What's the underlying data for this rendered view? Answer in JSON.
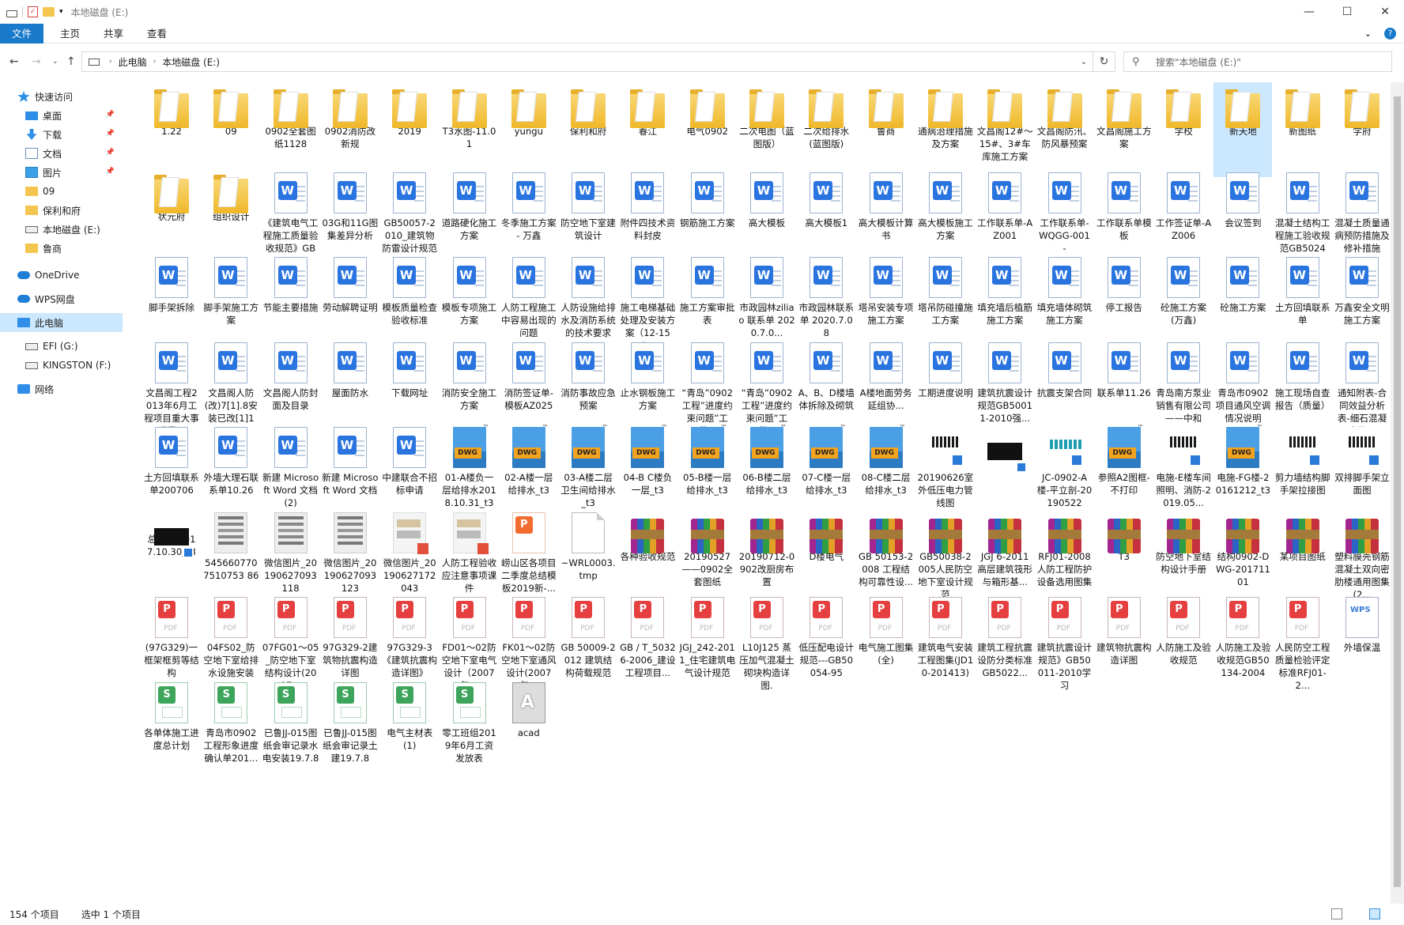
{
  "window": {
    "title": "本地磁盘 (E:)",
    "min": "—",
    "max": "☐",
    "close": "✕"
  },
  "ribbon": {
    "tabs": [
      "文件",
      "主页",
      "共享",
      "查看"
    ]
  },
  "address": {
    "crumbs": [
      "此电脑",
      "本地磁盘 (E:)"
    ],
    "search_placeholder": "搜索\"本地磁盘 (E:)\""
  },
  "sidebar": [
    {
      "label": "快速访问",
      "icon": "star-icon",
      "pinned": false
    },
    {
      "label": "桌面",
      "icon": "desktop-icon",
      "pinned": true
    },
    {
      "label": "下载",
      "icon": "download-icon",
      "pinned": true
    },
    {
      "label": "文档",
      "icon": "document-icon",
      "pinned": true
    },
    {
      "label": "图片",
      "icon": "picture-icon",
      "pinned": true
    },
    {
      "label": "09",
      "icon": "folder-icon",
      "pinned": false
    },
    {
      "label": "保利和府",
      "icon": "folder-icon",
      "pinned": false
    },
    {
      "label": "本地磁盘 (E:)",
      "icon": "drive-icon",
      "pinned": false
    },
    {
      "label": "鲁商",
      "icon": "folder-icon",
      "pinned": false
    },
    {
      "label": "OneDrive",
      "icon": "cloud-icon",
      "pinned": false
    },
    {
      "label": "WPS网盘",
      "icon": "cloud-icon",
      "pinned": false
    },
    {
      "label": "此电脑",
      "icon": "computer-icon",
      "pinned": false
    },
    {
      "label": "EFI (G:)",
      "icon": "drive-icon",
      "pinned": false
    },
    {
      "label": "KINGSTON (F:)",
      "icon": "drive-icon",
      "pinned": false
    },
    {
      "label": "网络",
      "icon": "network-icon",
      "pinned": false
    }
  ],
  "status": {
    "count": "154 个项目",
    "selected": "选中 1 个项目"
  },
  "files": [
    {
      "name": "1.22",
      "type": "folder"
    },
    {
      "name": "09",
      "type": "folder"
    },
    {
      "name": "0902全套图纸1128",
      "type": "folder"
    },
    {
      "name": "0902消防改新规",
      "type": "folder"
    },
    {
      "name": "2019",
      "type": "folder"
    },
    {
      "name": "T3水图-11.01",
      "type": "folder"
    },
    {
      "name": "yungu",
      "type": "folder"
    },
    {
      "name": "保利和府",
      "type": "folder"
    },
    {
      "name": "春江",
      "type": "folder"
    },
    {
      "name": "电气0902",
      "type": "folder"
    },
    {
      "name": "二次电图（蓝图版）",
      "type": "folder"
    },
    {
      "name": "二次给排水(蓝图版)",
      "type": "folder"
    },
    {
      "name": "鲁商",
      "type": "folder"
    },
    {
      "name": "通病治理措施及方案",
      "type": "folder"
    },
    {
      "name": "文昌阁12#～15#、3#车库施工方案",
      "type": "folder"
    },
    {
      "name": "文昌阁防汛、防风暴预案",
      "type": "folder"
    },
    {
      "name": "文昌阁施工方案",
      "type": "folder"
    },
    {
      "name": "学校",
      "type": "folder"
    },
    {
      "name": "新天地",
      "type": "folder",
      "selected": true
    },
    {
      "name": "新图纸",
      "type": "folder"
    },
    {
      "name": "学府",
      "type": "folder"
    },
    {
      "name": "状元府",
      "type": "folder"
    },
    {
      "name": "组织设计",
      "type": "folder"
    },
    {
      "name": "《建筑电气工程施工质量验收规范》GB5...",
      "type": "word"
    },
    {
      "name": "03G和11G图集差异分析",
      "type": "word"
    },
    {
      "name": "GB50057-2010_建筑物防雷设计规范",
      "type": "word"
    },
    {
      "name": "道路硬化施工方案",
      "type": "word"
    },
    {
      "name": "冬季施工方案 - 万鑫",
      "type": "word"
    },
    {
      "name": "防空地下室建筑设计",
      "type": "word"
    },
    {
      "name": "附件四技术资料封皮",
      "type": "word"
    },
    {
      "name": "钢筋施工方案",
      "type": "word"
    },
    {
      "name": "高大模板",
      "type": "word"
    },
    {
      "name": "高大模板1",
      "type": "word"
    },
    {
      "name": "高大模板计算书",
      "type": "word"
    },
    {
      "name": "高大模板施工方案",
      "type": "word"
    },
    {
      "name": "工作联系单-AZ001",
      "type": "word"
    },
    {
      "name": "工作联系单-WQGG-001 -",
      "type": "word"
    },
    {
      "name": "工作联系单模板",
      "type": "word"
    },
    {
      "name": "工作签证单-AZ006",
      "type": "word"
    },
    {
      "name": "会议签到",
      "type": "word"
    },
    {
      "name": "混凝土结构工程施工验收规范GB5024-...",
      "type": "word"
    },
    {
      "name": "混凝土质量通病预防措施及修补措施",
      "type": "word"
    },
    {
      "name": "脚手架拆除",
      "type": "word"
    },
    {
      "name": "脚手架施工方案",
      "type": "word"
    },
    {
      "name": "节能主要措施",
      "type": "word"
    },
    {
      "name": "劳动解聘证明",
      "type": "word"
    },
    {
      "name": "模板质量检查验收标准",
      "type": "word"
    },
    {
      "name": "模板专项施工方案",
      "type": "word"
    },
    {
      "name": "人防工程施工中容易出现的问题",
      "type": "word"
    },
    {
      "name": "人防设施给排水及消防系统的技术要求",
      "type": "word"
    },
    {
      "name": "施工电梯基础处理及安装方案（12-15#...",
      "type": "word"
    },
    {
      "name": "施工方案审批表",
      "type": "word"
    },
    {
      "name": "市政园林ziliao 联系单 2020.7.0...",
      "type": "word"
    },
    {
      "name": "市政园林联系单 2020.7.08",
      "type": "word"
    },
    {
      "name": "塔吊安装专项施工方案",
      "type": "word"
    },
    {
      "name": "塔吊防碰撞施工方案",
      "type": "word"
    },
    {
      "name": "填充墙后植筋施工方案",
      "type": "word"
    },
    {
      "name": "填充墙体砌筑施工方案",
      "type": "word"
    },
    {
      "name": "停工报告",
      "type": "word"
    },
    {
      "name": "砼施工方案(万鑫)",
      "type": "word"
    },
    {
      "name": "砼施工方案",
      "type": "word"
    },
    {
      "name": "土方回填联系单",
      "type": "word"
    },
    {
      "name": "万鑫安全文明施工方案",
      "type": "word"
    },
    {
      "name": "文昌阁工程2013年6月工程项目重大事项风...",
      "type": "word"
    },
    {
      "name": "文昌阁人防(改)7[1].8安装已改[1]1",
      "type": "word"
    },
    {
      "name": "文昌阁人防封面及目录",
      "type": "word"
    },
    {
      "name": "屋面防水",
      "type": "word"
    },
    {
      "name": "下载网址",
      "type": "word"
    },
    {
      "name": "消防安全施工方案",
      "type": "word"
    },
    {
      "name": "消防签证单-模板AZ025",
      "type": "word"
    },
    {
      "name": "消防事故应急预案",
      "type": "word"
    },
    {
      "name": "止水钢板施工方案",
      "type": "word"
    },
    {
      "name": "“青岛”0902工程”进度约束问题”工程...",
      "type": "word"
    },
    {
      "name": "“青岛”0902工程”进度约束问题”工程...",
      "type": "word"
    },
    {
      "name": "A、B、D楼墙体拆除及砌筑",
      "type": "word"
    },
    {
      "name": "A楼地面劳务延组协...",
      "type": "word"
    },
    {
      "name": "工期进度说明",
      "type": "word"
    },
    {
      "name": "建筑抗震设计规范GB50011-2010强...",
      "type": "word"
    },
    {
      "name": "抗震支架合同",
      "type": "word"
    },
    {
      "name": "联系单11.26",
      "type": "word"
    },
    {
      "name": "青岛南方泵业销售有限公司——中和",
      "type": "word"
    },
    {
      "name": "青岛市0902项目通风空调情况说明",
      "type": "word"
    },
    {
      "name": "施工现场自查报告（质量）",
      "type": "word"
    },
    {
      "name": "通知附表-合同效益分析表-细石混凝土施...",
      "type": "word"
    },
    {
      "name": "土方回填联系单200706",
      "type": "word"
    },
    {
      "name": "外墙大理石联系单10.26",
      "type": "word"
    },
    {
      "name": "新建 Microsoft Word 文档 (2)",
      "type": "word"
    },
    {
      "name": "新建 Microsoft Word 文档",
      "type": "word"
    },
    {
      "name": "中建联合不招标申请",
      "type": "word"
    },
    {
      "name": "01-A楼负一层给排水2018.10.31_t3",
      "type": "dwg"
    },
    {
      "name": "02-A楼一层给排水_t3",
      "type": "dwg"
    },
    {
      "name": "03-A楼二层卫生间给排水_t3",
      "type": "dwg"
    },
    {
      "name": "04-B C楼负一层_t3",
      "type": "dwg"
    },
    {
      "name": "05-B楼一层给排水_t3",
      "type": "dwg"
    },
    {
      "name": "06-B楼二层给排水_t3",
      "type": "dwg"
    },
    {
      "name": "07-C楼一层给排水_t3",
      "type": "dwg"
    },
    {
      "name": "08-C楼二层给排水_t3",
      "type": "dwg"
    },
    {
      "name": "20190626室外低压电力管线图",
      "type": "mixed"
    },
    {
      "name": "D楼宿舍",
      "type": "dark"
    },
    {
      "name": "JC-0902-A楼-平立剖-20190522",
      "type": "cyan"
    },
    {
      "name": "参照A2图框-不打印",
      "type": "dwg"
    },
    {
      "name": "电施-E楼车间照明、消防-2019.05...",
      "type": "mixed"
    },
    {
      "name": "电施-FG楼-20161212_t3",
      "type": "dwg"
    },
    {
      "name": "剪力墙结构脚手架拉接图",
      "type": "mixed"
    },
    {
      "name": "双排脚手架立面图",
      "type": "mixed"
    },
    {
      "name": "总说明-2017.10.30_t3",
      "type": "dark"
    },
    {
      "name": "5456607707510753 86",
      "type": "img"
    },
    {
      "name": "微信图片_20190627093118",
      "type": "img"
    },
    {
      "name": "微信图片_20190627093123",
      "type": "img"
    },
    {
      "name": "微信图片_20190627172043",
      "type": "thumb"
    },
    {
      "name": "人防工程验收应注意事项课件",
      "type": "thumb"
    },
    {
      "name": "崂山区各项目二季度总结模板2019新-...",
      "type": "ppt"
    },
    {
      "name": "~WRL0003.tmp",
      "type": "tmp"
    },
    {
      "name": "各种验收规范",
      "type": "rar"
    },
    {
      "name": "20190527——0902全套图纸",
      "type": "rar"
    },
    {
      "name": "20190712-0902改厨房布置",
      "type": "rar"
    },
    {
      "name": "D楼电气",
      "type": "rar"
    },
    {
      "name": "GB 50153-2008 工程结构可靠性设...",
      "type": "rar"
    },
    {
      "name": "GB50038-2005人民防空地下室设计规范",
      "type": "rar"
    },
    {
      "name": "JGJ 6-2011 高层建筑筏形与箱形基...",
      "type": "rar"
    },
    {
      "name": "RFJ01-2008人防工程防护设备选用图集",
      "type": "rar"
    },
    {
      "name": "T3",
      "type": "rar"
    },
    {
      "name": "防空地下室结构设计手册",
      "type": "rar"
    },
    {
      "name": "结构0902-DWG-20171101",
      "type": "rar"
    },
    {
      "name": "某项目图纸",
      "type": "rar"
    },
    {
      "name": "塑料膜壳钢筋混凝土双向密肋楼通用图集(2...",
      "type": "rar"
    },
    {
      "name": "(97G329)一框架框剪等结构",
      "type": "pdf"
    },
    {
      "name": "04FS02_防空地下室给排水设施安装",
      "type": "pdf"
    },
    {
      "name": "07FG01～05_防空地下室结构设计(2007...",
      "type": "pdf"
    },
    {
      "name": "97G329-2建筑物抗震构造详图",
      "type": "pdf"
    },
    {
      "name": "97G329-3《建筑抗震构造详图》",
      "type": "pdf"
    },
    {
      "name": "FD01～02防空地下室电气设计（2007年...",
      "type": "pdf"
    },
    {
      "name": "FK01～02防空地下室通风设计(2007年...",
      "type": "pdf"
    },
    {
      "name": "GB 50009-2012 建筑结构荷载规范",
      "type": "pdf"
    },
    {
      "name": "GB / T_50326-2006_建设工程项目...",
      "type": "pdf"
    },
    {
      "name": "JGJ_242-2011_住宅建筑电气设计规范",
      "type": "pdf"
    },
    {
      "name": "L10J125 蒸压加气混凝土砌块构造详图.",
      "type": "pdf"
    },
    {
      "name": "低压配电设计规范---GB50054-95",
      "type": "pdf"
    },
    {
      "name": "电气施工图集(全)",
      "type": "pdf"
    },
    {
      "name": "建筑电气安装工程图集(JD10-201413)",
      "type": "pdf"
    },
    {
      "name": "建筑工程抗震设防分类标准GB5022...",
      "type": "pdf"
    },
    {
      "name": "建筑抗震设计规范》GB50011-2010学习",
      "type": "pdf"
    },
    {
      "name": "建筑物抗震构造详图",
      "type": "pdf"
    },
    {
      "name": "人防施工及验收规范",
      "type": "pdf"
    },
    {
      "name": "人防施工及验收规范GB50134-2004",
      "type": "pdf"
    },
    {
      "name": "人民防空工程质量检验评定标准RFJ01-2...",
      "type": "pdf"
    },
    {
      "name": "外墙保温",
      "type": "wps"
    },
    {
      "name": "各单体施工进度总计划",
      "type": "xls"
    },
    {
      "name": "青岛市0902工程形象进度确认单201...",
      "type": "xls"
    },
    {
      "name": "已鲁JJ-015图纸会审记录水电安装19.7.8",
      "type": "xls"
    },
    {
      "name": "已鲁JJ-015图纸会审记录土建19.7.8",
      "type": "xls"
    },
    {
      "name": "电气主材表(1)",
      "type": "xls"
    },
    {
      "name": "零工班组2019年6月工资发放表",
      "type": "xls"
    },
    {
      "name": "acad",
      "type": "acad"
    }
  ]
}
